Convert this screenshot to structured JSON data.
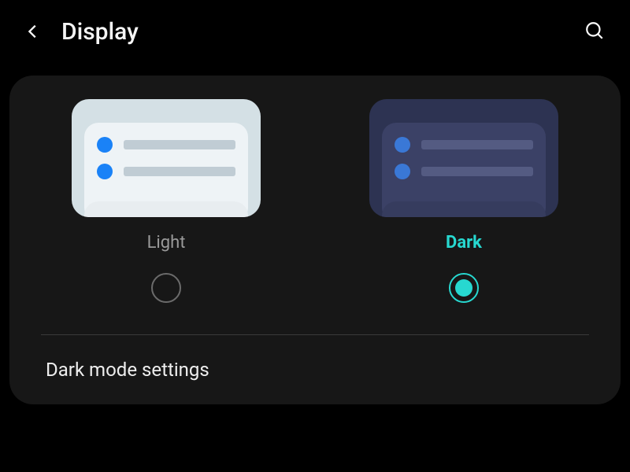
{
  "header": {
    "title": "Display"
  },
  "themes": {
    "light": {
      "label": "Light",
      "selected": false
    },
    "dark": {
      "label": "Dark",
      "selected": true
    }
  },
  "settings": {
    "dark_mode_settings_label": "Dark mode settings"
  },
  "colors": {
    "accent": "#27d8d0",
    "background": "#000000",
    "card": "#171717"
  }
}
